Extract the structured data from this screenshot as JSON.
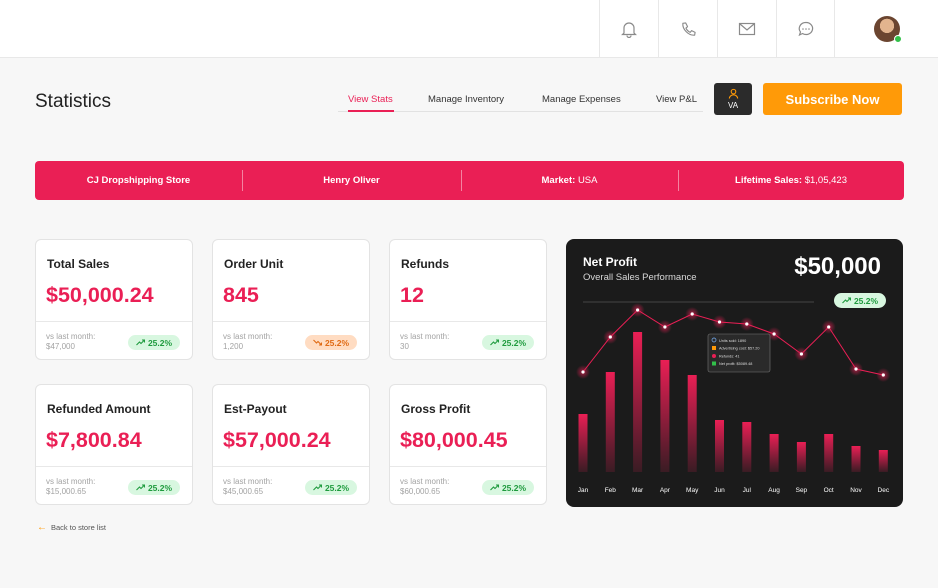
{
  "header": {
    "icons": [
      "bell-icon",
      "phone-icon",
      "mail-icon",
      "chat-icon"
    ],
    "avatar": "user-avatar"
  },
  "page": {
    "title": "Statistics"
  },
  "tabs": [
    {
      "label": "View Stats",
      "active": true
    },
    {
      "label": "Manage Inventory",
      "active": false
    },
    {
      "label": "Manage Expenses",
      "active": false
    },
    {
      "label": "View P&L",
      "active": false
    }
  ],
  "va_button": {
    "label": "VA"
  },
  "subscribe_button": {
    "label": "Subscribe Now"
  },
  "store_bar": {
    "store": "CJ Dropshipping Store",
    "owner": "Henry Oliver",
    "market_label": "Market:",
    "market_value": "USA",
    "lifetime_label": "Lifetime Sales:",
    "lifetime_value": "$1,05,423"
  },
  "cards": [
    {
      "label": "Total Sales",
      "value": "$50,000.24",
      "vs": "vs last month:",
      "prev": "$47,000",
      "change": "25.2%",
      "trend": "up"
    },
    {
      "label": "Order Unit",
      "value": "845",
      "vs": "vs last month:",
      "prev": "1,200",
      "change": "25.2%",
      "trend": "down"
    },
    {
      "label": "Refunds",
      "value": "12",
      "vs": "vs last month:",
      "prev": "30",
      "change": "25.2%",
      "trend": "up"
    },
    {
      "label": "Refunded Amount",
      "value": "$7,800.84",
      "vs": "vs last month:",
      "prev": "$15,000.65",
      "change": "25.2%",
      "trend": "up"
    },
    {
      "label": "Est-Payout",
      "value": "$57,000.24",
      "vs": "vs last month:",
      "prev": "$45,000.65",
      "change": "25.2%",
      "trend": "up"
    },
    {
      "label": "Gross Profit",
      "value": "$80,000.45",
      "vs": "vs last month:",
      "prev": "$60,000.65",
      "change": "25.2%",
      "trend": "up"
    }
  ],
  "net_profit": {
    "title": "Net Profit",
    "subtitle": "Overall Sales Performance",
    "value": "$50,000",
    "change": "25.2%"
  },
  "chart_data": {
    "type": "bar",
    "categories": [
      "Jan",
      "Feb",
      "Mar",
      "Apr",
      "May",
      "Jun",
      "Jul",
      "Aug",
      "Sep",
      "Oct",
      "Nov",
      "Dec"
    ],
    "series": [
      {
        "values": [
          58,
          100,
          140,
          112,
          97,
          52,
          50,
          38,
          30,
          38,
          26,
          22
        ]
      },
      {
        "values": [
          100,
          135,
          162,
          145,
          158,
          150,
          148,
          138,
          118,
          145,
          103,
          97
        ]
      }
    ],
    "tooltip": [
      "Units sold: 1890",
      "Advertising cost: $57.20",
      "Refunds: 41",
      "Net profit: $5089.48"
    ],
    "colors": {
      "bars": "#ea1f55",
      "line": "#ea1f55",
      "tooltip_box": "#2a2a2a"
    }
  },
  "back_link": {
    "label": "Back to store list"
  },
  "colors": {
    "accent": "#ea1f55",
    "orange": "#ff9a08",
    "positive": "#1f9b3e"
  }
}
